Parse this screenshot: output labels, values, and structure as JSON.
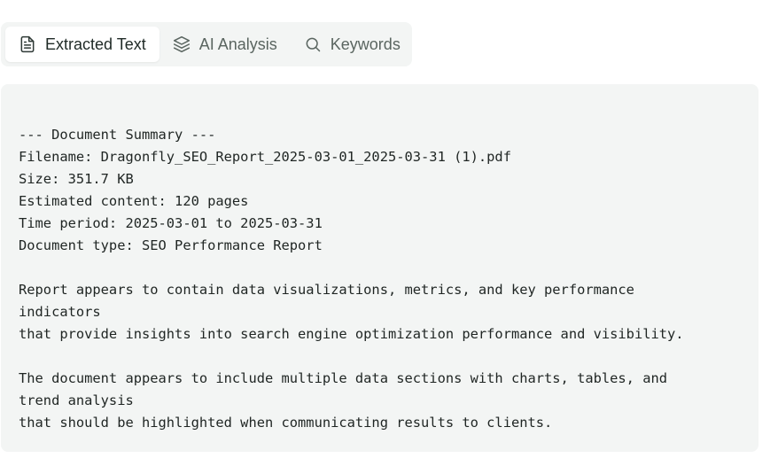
{
  "tabs": [
    {
      "label": "Extracted Text",
      "icon": "document-icon",
      "active": true
    },
    {
      "label": "AI Analysis",
      "icon": "layers-icon",
      "active": false
    },
    {
      "label": "Keywords",
      "icon": "search-icon",
      "active": false
    }
  ],
  "extracted_text": {
    "lines": [
      "--- Document Summary ---",
      "Filename: Dragonfly_SEO_Report_2025-03-01_2025-03-31 (1).pdf",
      "Size: 351.7 KB",
      "Estimated content: 120 pages",
      "Time period: 2025-03-01 to 2025-03-31",
      "Document type: SEO Performance Report",
      "",
      "Report appears to contain data visualizations, metrics, and key performance",
      "indicators",
      "that provide insights into search engine optimization performance and visibility.",
      "",
      "The document appears to include multiple data sections with charts, tables, and",
      "trend analysis",
      "that should be highlighted when communicating results to clients."
    ]
  },
  "colors": {
    "tab_bar_bg": "#f3f5f4",
    "active_tab_bg": "#ffffff",
    "panel_bg": "#f3f5f4"
  }
}
